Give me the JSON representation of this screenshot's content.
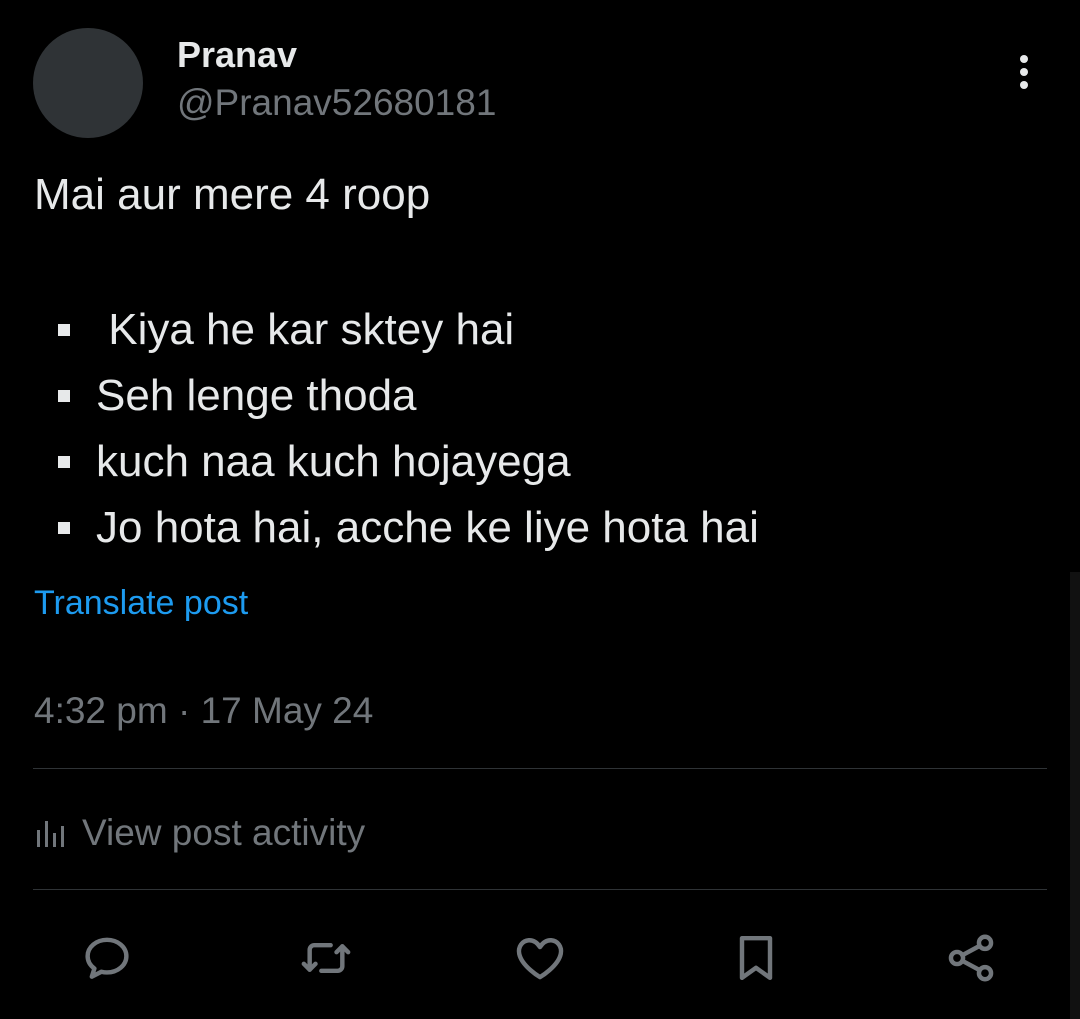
{
  "author": {
    "display_name": "Pranav",
    "handle": "@Pranav52680181"
  },
  "post": {
    "intro": "Mai aur mere 4 roop",
    "bullets": [
      " Kiya he kar sktey hai",
      "Seh lenge thoda",
      "kuch naa kuch hojayega",
      "Jo hota hai, acche ke liye hota hai"
    ],
    "translate_label": "Translate post",
    "timestamp": "4:32 pm · 17 May 24"
  },
  "activity": {
    "label": "View post activity",
    "icon": "bar-chart-icon"
  },
  "actions": [
    {
      "name": "reply",
      "icon": "speech-bubble-icon"
    },
    {
      "name": "repost",
      "icon": "repost-arrows-icon"
    },
    {
      "name": "like",
      "icon": "heart-icon"
    },
    {
      "name": "bookmark",
      "icon": "bookmark-icon"
    },
    {
      "name": "share",
      "icon": "share-nodes-icon"
    }
  ],
  "colors": {
    "background": "#000000",
    "text": "#e7e9ea",
    "secondary_text": "#71767b",
    "link": "#1d9bf0",
    "divider": "#2f3336"
  }
}
